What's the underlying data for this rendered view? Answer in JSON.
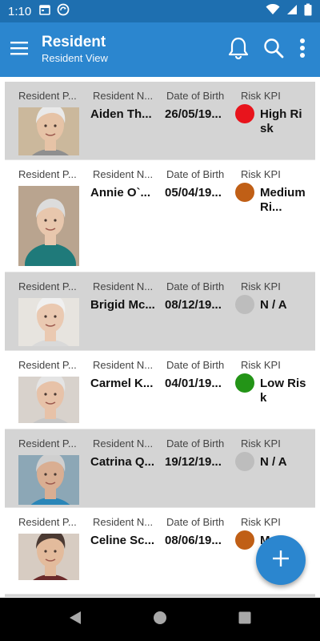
{
  "status_bar": {
    "time": "1:10",
    "icons": [
      "calendar-icon",
      "sync-icon",
      "wifi-icon",
      "signal-icon",
      "battery-icon"
    ]
  },
  "app_bar": {
    "title": "Resident",
    "subtitle": "Resident View",
    "icons": [
      "menu-icon",
      "bell-icon",
      "search-icon",
      "more-vert-icon"
    ]
  },
  "headers": {
    "photo": "Resident P...",
    "name": "Resident N...",
    "dob": "Date of Birth",
    "risk": "Risk KPI"
  },
  "residents": [
    {
      "name": "Aiden Th...",
      "dob": "26/05/19...",
      "risk": "High Risk",
      "risk_color": "#e8141c",
      "shaded": true
    },
    {
      "name": "Annie O`...",
      "dob": "05/04/19...",
      "risk": "Medium Ri...",
      "risk_color": "#c05f16",
      "shaded": false
    },
    {
      "name": "Brigid Mc...",
      "dob": "08/12/19...",
      "risk": "N / A",
      "risk_color": "#bdbdbd",
      "shaded": true
    },
    {
      "name": "Carmel K...",
      "dob": "04/01/19...",
      "risk": "Low Risk",
      "risk_color": "#239417",
      "shaded": false
    },
    {
      "name": "Catrina Q...",
      "dob": "19/12/19...",
      "risk": "N / A",
      "risk_color": "#bdbdbd",
      "shaded": true
    },
    {
      "name": "Celine Sc...",
      "dob": "08/06/19...",
      "risk": "M...",
      "risk_color": "#c05f16",
      "shaded": false
    }
  ],
  "fab_icon": "plus-icon",
  "nav_bar": {
    "icons": [
      "back-icon",
      "home-icon",
      "recents-icon"
    ]
  },
  "colors": {
    "status_bar": "#1e6fb0",
    "app_bar": "#2b86cf",
    "shaded_row": "#d4d4d4"
  }
}
